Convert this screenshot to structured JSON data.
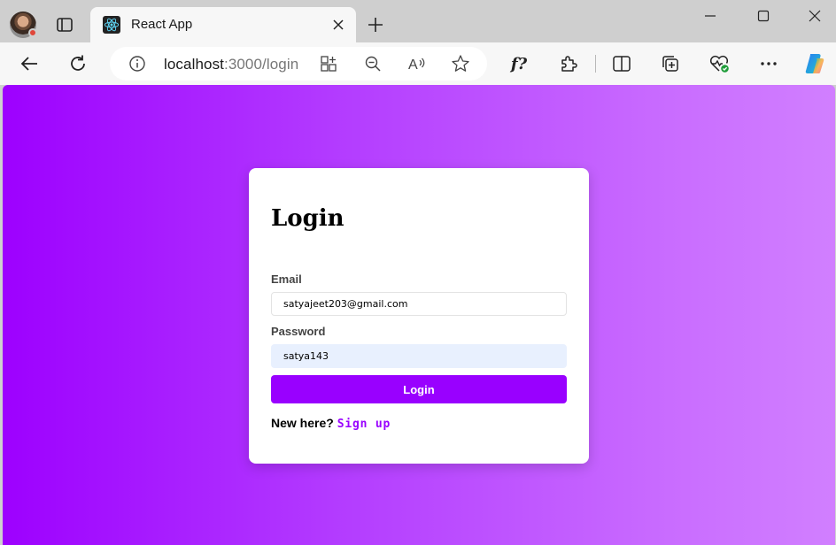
{
  "browser": {
    "tab": {
      "title": "React App",
      "favicon": "react-logo-icon"
    },
    "address": {
      "host": "localhost",
      "rest": ":3000/login"
    },
    "icons": [
      "profile-avatar",
      "tab-actions-icon",
      "close-icon",
      "new-tab-icon",
      "minimize-icon",
      "maximize-icon",
      "window-close-icon",
      "back-icon",
      "refresh-icon",
      "site-info-icon",
      "app-available-icon",
      "zoom-out-icon",
      "read-aloud-icon",
      "favorite-star-icon",
      "font-f-icon",
      "extensions-icon",
      "split-screen-icon",
      "collections-icon",
      "browser-essentials-icon",
      "more-icon",
      "copilot-icon"
    ],
    "font_button_label": "f?"
  },
  "page": {
    "colors": {
      "gradient_start": "#9d00ff",
      "gradient_end": "#d17fff",
      "accent": "#9900ff",
      "card": "#ffffff"
    },
    "login": {
      "title": "Login",
      "email_label": "Email",
      "email_value": "satyajeet203@gmail.com",
      "password_label": "Password",
      "password_value": "satya143",
      "submit_label": "Login",
      "signup_prompt": "New here?",
      "signup_link": "Sign up"
    }
  }
}
